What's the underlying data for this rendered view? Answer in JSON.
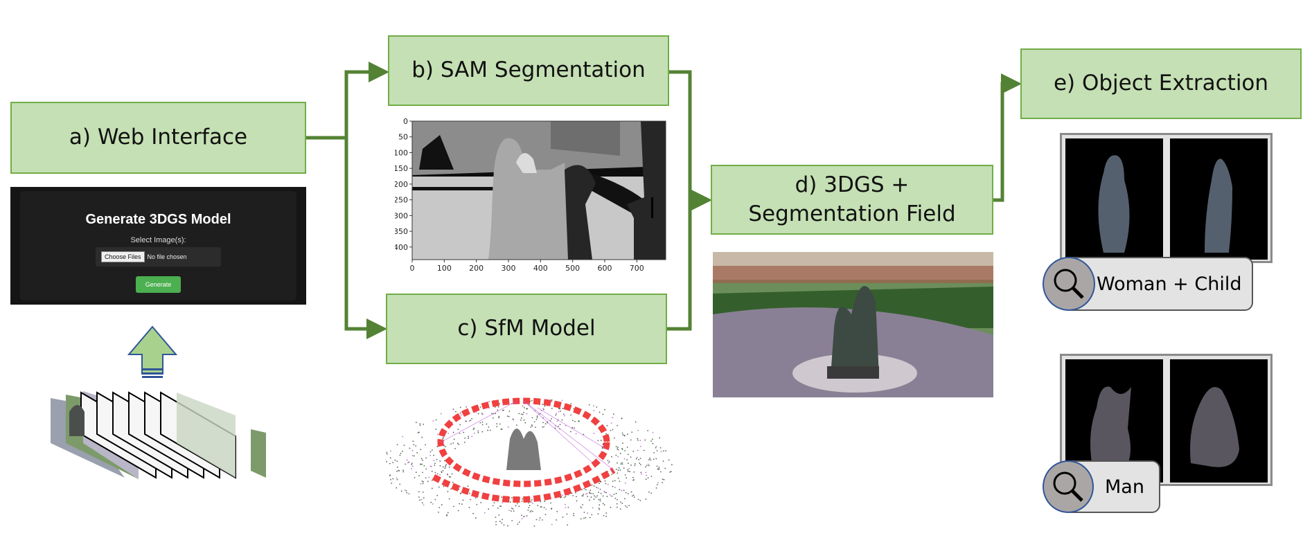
{
  "stages": {
    "a": {
      "label": "a) Web Interface"
    },
    "b": {
      "label": "b) SAM Segmentation"
    },
    "c": {
      "label": "c) SfM Model"
    },
    "d": {
      "label_line1": "d) 3DGS +",
      "label_line2": "Segmentation Field"
    },
    "e": {
      "label": "e) Object Extraction"
    }
  },
  "web_interface": {
    "title": "Generate 3DGS Model",
    "select_label": "Select Image(s):",
    "choose_files": "Choose Files",
    "no_file": "No file chosen",
    "generate": "Generate",
    "accent_color": "#4caf50"
  },
  "sam_plot": {
    "x_ticks": [
      "0",
      "100",
      "200",
      "300",
      "400",
      "500",
      "600",
      "700"
    ],
    "y_ticks": [
      "0",
      "50",
      "100",
      "150",
      "200",
      "250",
      "300",
      "350",
      "400"
    ],
    "xlim": [
      0,
      790
    ],
    "ylim": [
      440,
      0
    ]
  },
  "objects": [
    {
      "query": "Woman + Child",
      "icon": "magnifier-icon"
    },
    {
      "query": "Man",
      "icon": "magnifier-icon"
    }
  ],
  "colors": {
    "stage_fill": "#c5e0b4",
    "stage_border": "#70ad47",
    "connector": "#548235",
    "upload_arrow": "#a9d18e"
  }
}
